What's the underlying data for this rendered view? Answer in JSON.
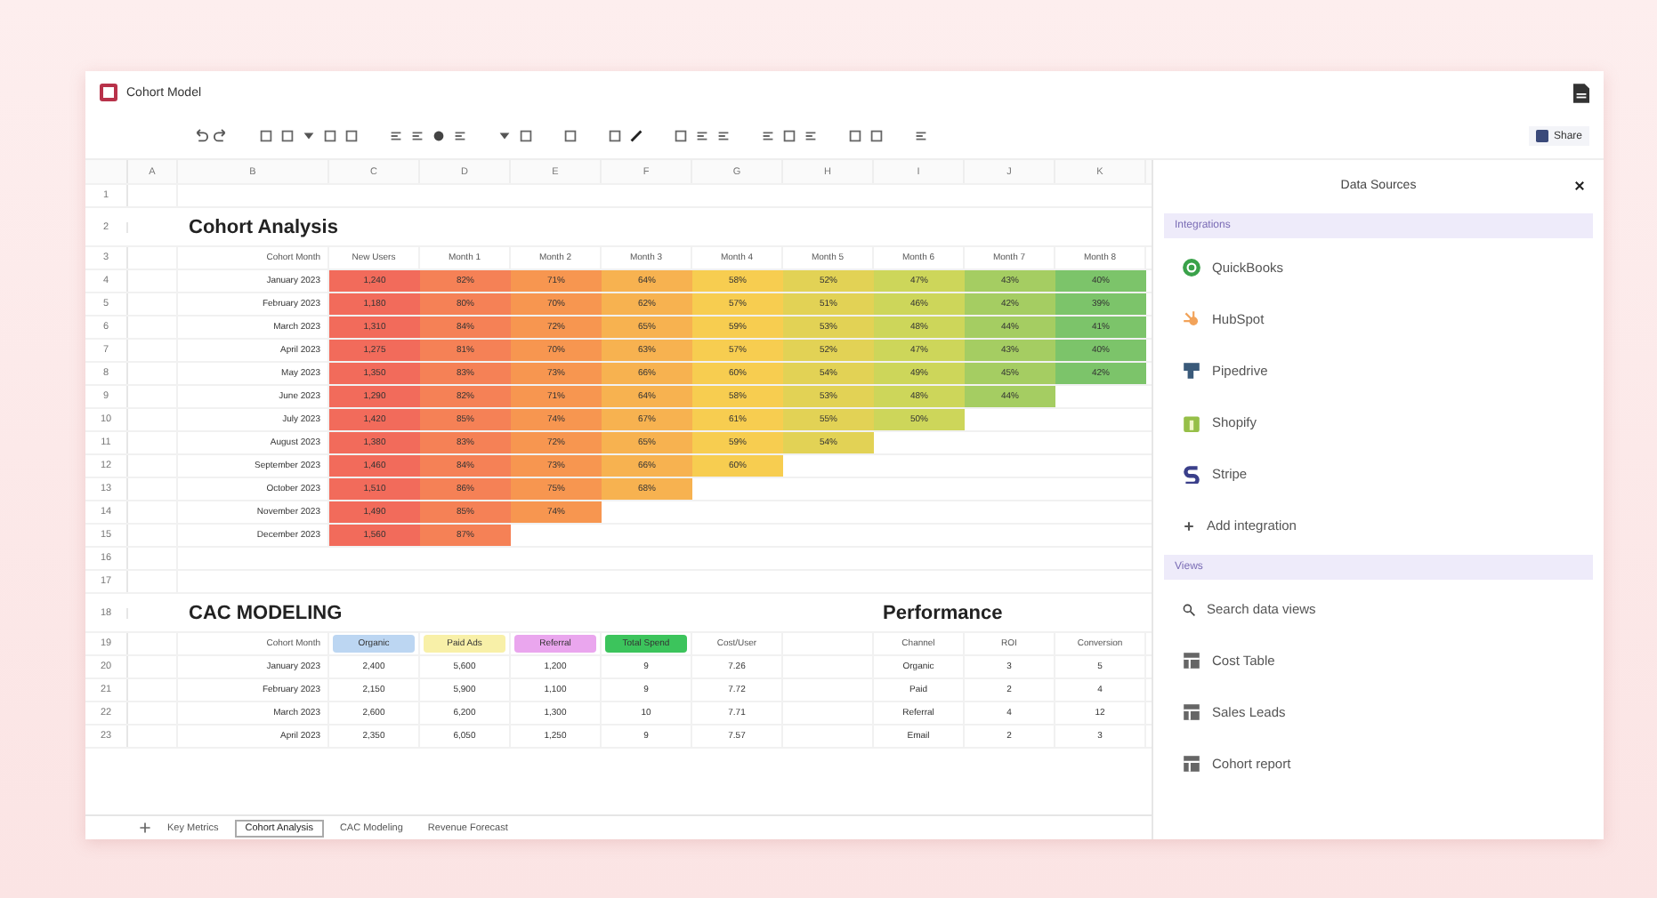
{
  "window": {
    "title": "Cohort Model"
  },
  "toolbar": {
    "share_button": "Share"
  },
  "sheet": {
    "columns": [
      "A",
      "B",
      "C",
      "D",
      "E",
      "F",
      "G",
      "H",
      "I",
      "J",
      "K"
    ],
    "row_numbers": [
      "1",
      "2",
      "3",
      "4",
      "5",
      "6",
      "7",
      "8",
      "9",
      "10",
      "11",
      "12",
      "13",
      "14",
      "15",
      "16",
      "17",
      "18",
      "19",
      "20",
      "21",
      "22",
      "23"
    ],
    "cohort": {
      "title": "Cohort Analysis",
      "header": [
        "Cohort Month",
        "New Users",
        "Month 1",
        "Month 2",
        "Month 3",
        "Month 4",
        "Month 5",
        "Month 6",
        "Month 7",
        "Month 8"
      ],
      "rows": [
        {
          "label": "January 2023",
          "cells": [
            "1,240",
            "82%",
            "71%",
            "64%",
            "58%",
            "52%",
            "47%",
            "43%",
            "40%"
          ]
        },
        {
          "label": "February 2023",
          "cells": [
            "1,180",
            "80%",
            "70%",
            "62%",
            "57%",
            "51%",
            "46%",
            "42%",
            "39%"
          ]
        },
        {
          "label": "March 2023",
          "cells": [
            "1,310",
            "84%",
            "72%",
            "65%",
            "59%",
            "53%",
            "48%",
            "44%",
            "41%"
          ]
        },
        {
          "label": "April 2023",
          "cells": [
            "1,275",
            "81%",
            "70%",
            "63%",
            "57%",
            "52%",
            "47%",
            "43%",
            "40%"
          ]
        },
        {
          "label": "May 2023",
          "cells": [
            "1,350",
            "83%",
            "73%",
            "66%",
            "60%",
            "54%",
            "49%",
            "45%",
            "42%"
          ]
        },
        {
          "label": "June 2023",
          "cells": [
            "1,290",
            "82%",
            "71%",
            "64%",
            "58%",
            "53%",
            "48%",
            "44%"
          ]
        },
        {
          "label": "July 2023",
          "cells": [
            "1,420",
            "85%",
            "74%",
            "67%",
            "61%",
            "55%",
            "50%"
          ]
        },
        {
          "label": "August 2023",
          "cells": [
            "1,380",
            "83%",
            "72%",
            "65%",
            "59%",
            "54%"
          ]
        },
        {
          "label": "September 2023",
          "cells": [
            "1,460",
            "84%",
            "73%",
            "66%",
            "60%"
          ]
        },
        {
          "label": "October 2023",
          "cells": [
            "1,510",
            "86%",
            "75%",
            "68%"
          ]
        },
        {
          "label": "November 2023",
          "cells": [
            "1,490",
            "85%",
            "74%"
          ]
        },
        {
          "label": "December 2023",
          "cells": [
            "1,560",
            "87%"
          ]
        }
      ]
    },
    "cac": {
      "title": "CAC MODELING",
      "header_label": "Cohort Month",
      "channels": [
        {
          "label": "Organic",
          "color": "#bcd6f2"
        },
        {
          "label": "Paid Ads",
          "color": "#f8f0a8"
        },
        {
          "label": "Referral",
          "color": "#eaa6ee"
        },
        {
          "label": "Total Spend",
          "color": "#3cc45c"
        }
      ],
      "last_header": "Cost/User",
      "rows": [
        {
          "label": "January 2023",
          "cells": [
            "2,400",
            "5,600",
            "1,200",
            "9",
            "7.26"
          ]
        },
        {
          "label": "February 2023",
          "cells": [
            "2,150",
            "5,900",
            "1,100",
            "9",
            "7.72"
          ]
        },
        {
          "label": "March 2023",
          "cells": [
            "2,600",
            "6,200",
            "1,300",
            "10",
            "7.71"
          ]
        },
        {
          "label": "April 2023",
          "cells": [
            "2,350",
            "6,050",
            "1,250",
            "9",
            "7.57"
          ]
        }
      ]
    },
    "performance": {
      "title": "Performance",
      "columns": [
        "Channel",
        "ROI",
        "Conversion"
      ],
      "rows": [
        [
          "Organic",
          "3",
          "5"
        ],
        [
          "Paid",
          "2",
          "4"
        ],
        [
          "Referral",
          "4",
          "12"
        ],
        [
          "Email",
          "2",
          "3"
        ]
      ]
    }
  },
  "sheet_tabs": [
    {
      "label": "Key Metrics",
      "selected": false
    },
    {
      "label": "Cohort Analysis",
      "selected": true
    },
    {
      "label": "CAC Modeling",
      "selected": false
    },
    {
      "label": "Revenue Forecast",
      "selected": false
    }
  ],
  "side_panel": {
    "title": "Data Sources",
    "sections": [
      {
        "title": "Integrations",
        "items": [
          {
            "label": "QuickBooks",
            "kind": "ring"
          },
          {
            "label": "HubSpot",
            "kind": "burst"
          },
          {
            "label": "Pipedrive",
            "kind": "pillar"
          },
          {
            "label": "Shopify",
            "kind": "bag"
          },
          {
            "label": "Stripe",
            "kind": "wave"
          },
          {
            "label": "Add integration",
            "kind": "plus"
          }
        ]
      },
      {
        "title": "Views",
        "items": [
          {
            "label": "Search data views",
            "kind": "search"
          },
          {
            "label": "Cost Table",
            "kind": "table"
          },
          {
            "label": "Sales Leads",
            "kind": "table"
          },
          {
            "label": "Cohort report",
            "kind": "table"
          }
        ]
      }
    ]
  }
}
